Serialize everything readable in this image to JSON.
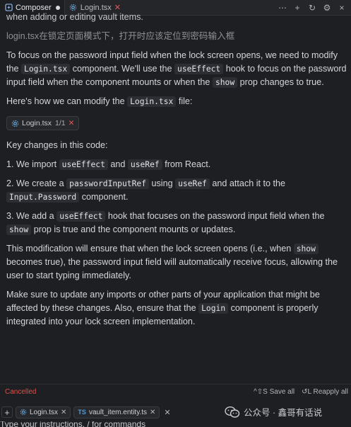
{
  "tabs": [
    {
      "label": "Composer",
      "active": true
    },
    {
      "label": "Login.tsx",
      "active": false
    }
  ],
  "tab_actions": {
    "more": "⋯",
    "add": "+",
    "history": "↻",
    "settings": "⚙",
    "close": "×"
  },
  "message": {
    "cut_line": "when adding or editing vault items.",
    "user_prompt": "login.tsx在锁定页面模式下，打开时应该定位到密码输入框",
    "intro": {
      "t1": "To focus on the password input field when the lock screen opens, we need to modify the ",
      "c1": "Login.tsx",
      "t2": " component. We'll use the ",
      "c2": "useEffect",
      "t3": " hook to focus on the password input field when the component mounts or when the ",
      "c3": "show",
      "t4": " prop changes to true."
    },
    "how": {
      "t1": "Here's how we can modify the ",
      "c1": "Login.tsx",
      "t2": " file:"
    },
    "file_chip": {
      "name": "Login.tsx",
      "count": "1/1"
    },
    "key_changes": "Key changes in this code:",
    "item1": {
      "t1": "1. We import ",
      "c1": "useEffect",
      "t2": " and ",
      "c2": "useRef",
      "t3": " from React."
    },
    "item2": {
      "t1": "2. We create a ",
      "c1": "passwordInputRef",
      "t2": " using ",
      "c2": "useRef",
      "t3": " and attach it to the ",
      "c3": "Input.Password",
      "t4": " component."
    },
    "item3": {
      "t1": "3. We add a ",
      "c1": "useEffect",
      "t2": " hook that focuses on the password input field when the ",
      "c2": "show",
      "t3": " prop is true and the component mounts or updates."
    },
    "outcome": {
      "t1": "This modification will ensure that when the lock screen opens (i.e., when ",
      "c1": "show",
      "t2": " becomes true), the password input field will automatically receive focus, allowing the user to start typing immediately."
    },
    "closing": {
      "t1": "Make sure to update any imports or other parts of your application that might be affected by these changes. Also, ensure that the ",
      "c1": "Login",
      "t2": " component is properly integrated into your lock screen implementation."
    }
  },
  "status": {
    "cancelled": "Cancelled",
    "save_all": "^⇧S Save all",
    "reapply_all": "↺L Reapply all"
  },
  "context_chips": [
    {
      "label": "Login.tsx",
      "icon": "gear-icon"
    },
    {
      "label": "vault_item.entity.ts",
      "icon": "TS"
    }
  ],
  "input_placeholder": "Type your instructions, / for commands",
  "watermark": {
    "text": "公众号 · 鑫哥有话说"
  }
}
